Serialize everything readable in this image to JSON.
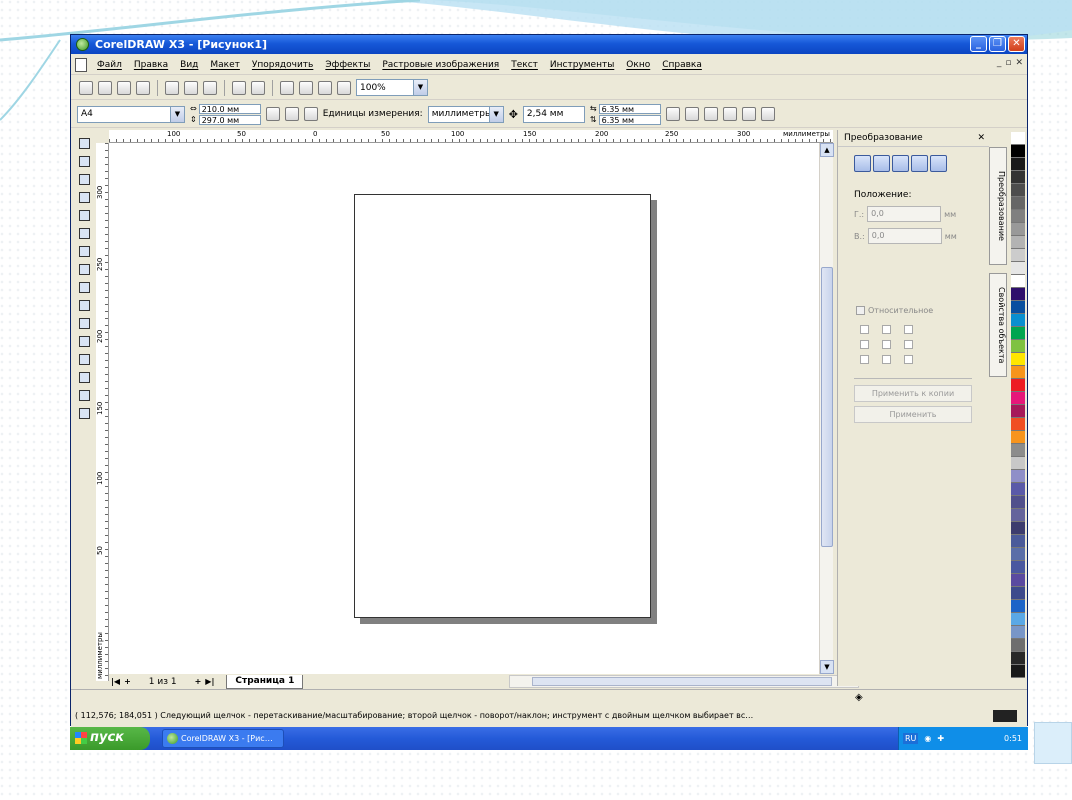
{
  "window": {
    "title": "CorelDRAW X3 - [Рисунок1]"
  },
  "menu": {
    "items": [
      "Файл",
      "Правка",
      "Вид",
      "Макет",
      "Упорядочить",
      "Эффекты",
      "Растровые изображения",
      "Текст",
      "Инструменты",
      "Окно",
      "Справка"
    ]
  },
  "toolbar": {
    "zoom": "100%"
  },
  "propbar": {
    "paper": "A4",
    "width": "210.0 мм",
    "height": "297.0 мм",
    "units_label": "Единицы измерения:",
    "units_value": "миллиметры",
    "nudge": "2,54 мм",
    "dup_x": "6.35 мм",
    "dup_y": "6.35 мм"
  },
  "rulers": {
    "h_ticks": [
      "100",
      "50",
      "0",
      "50",
      "100",
      "150",
      "200",
      "250",
      "300"
    ],
    "h_unit": "миллиметры",
    "v_ticks": [
      "300",
      "250",
      "200",
      "150",
      "100",
      "50"
    ],
    "v_unit": "миллиметры"
  },
  "pagebar": {
    "page_count": "1 из 1",
    "page_tab": "Страница 1"
  },
  "docker": {
    "title": "Преобразование",
    "position_label": "Положение:",
    "h_label": "Г.:",
    "h_value": "0,0",
    "v_label": "В.:",
    "v_value": "0,0",
    "unit": "мм",
    "relative_label": "Относительное",
    "apply_copy": "Применить к копии",
    "apply": "Применить",
    "tab1": "Преобразование",
    "tab2": "Свойства объекта"
  },
  "palette": {
    "colors": [
      "#ffffff",
      "#000000",
      "#1a1a1a",
      "#333333",
      "#4d4d4d",
      "#666666",
      "#808080",
      "#999999",
      "#b3b3b3",
      "#cccccc",
      "#e6e6e6",
      "#ffffff",
      "#2e0f6b",
      "#0a4fa0",
      "#0a8fd0",
      "#00a550",
      "#7fc241",
      "#ffe600",
      "#f7941d",
      "#ed1c24",
      "#e6177a",
      "#a6195a",
      "#f04e23",
      "#f7941d",
      "#8c8c8c",
      "#c8c8c8",
      "#8f8fc8",
      "#5a5aa8",
      "#50508c",
      "#64649c",
      "#3c3c6e",
      "#4a5a9a",
      "#5a6ea8",
      "#4a58a0",
      "#5a4aa0",
      "#3d4a8c",
      "#1c64c8",
      "#5aa8e6",
      "#7896c8",
      "#6e6e6e",
      "#282828",
      "#191919"
    ]
  },
  "status": {
    "text": "( 112,576; 184,051 )    Следующий щелчок - перетаскивание/масштабирование; второй щелчок - поворот/наклон; инструмент с двойным щелчком выбирает вс…"
  },
  "taskbar": {
    "start": "пуск",
    "task": "CorelDRAW X3 - [Рис…",
    "lang": "RU",
    "clock": "0:51"
  }
}
